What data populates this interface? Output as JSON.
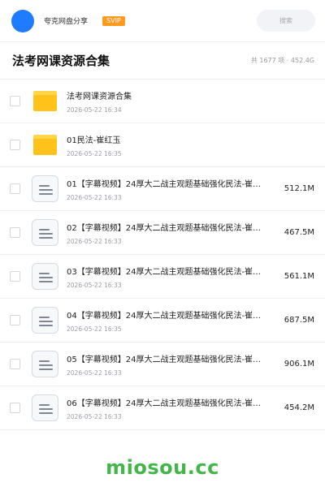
{
  "header": {
    "user_name": "夸克网盘分享",
    "badge": "SVIP",
    "search_placeholder": "搜索"
  },
  "folder": {
    "title": "法考网课资源合集",
    "stats": "共 1677 项 · 452.4G"
  },
  "files": [
    {
      "type": "folder",
      "name": "法考网课资源合集",
      "date": "2026-05-22 16:34",
      "size": ""
    },
    {
      "type": "folder",
      "name": "01民法-崔红玉",
      "date": "2026-05-22 16:35",
      "size": ""
    },
    {
      "type": "doc",
      "name": "01【字幕视频】24厚大二战主观题基础强化民法-崔…",
      "date": "2026-05-22 16:33",
      "size": "512.1M"
    },
    {
      "type": "doc",
      "name": "02【字幕视频】24厚大二战主观题基础强化民法-崔…",
      "date": "2026-05-22 16:33",
      "size": "467.5M"
    },
    {
      "type": "doc",
      "name": "03【字幕视频】24厚大二战主观题基础强化民法-崔…",
      "date": "2026-05-22 16:33",
      "size": "561.1M"
    },
    {
      "type": "doc",
      "name": "04【字幕视频】24厚大二战主观题基础强化民法-崔…",
      "date": "2026-05-22 16:35",
      "size": "687.5M"
    },
    {
      "type": "doc",
      "name": "05【字幕视频】24厚大二战主观题基础强化民法-崔…",
      "date": "2026-05-22 16:33",
      "size": "906.1M"
    },
    {
      "type": "doc",
      "name": "06【字幕视频】24厚大二战主观题基础强化民法-崔…",
      "date": "2026-05-22 16:33",
      "size": "454.2M"
    }
  ],
  "watermark": "miosou.cc"
}
